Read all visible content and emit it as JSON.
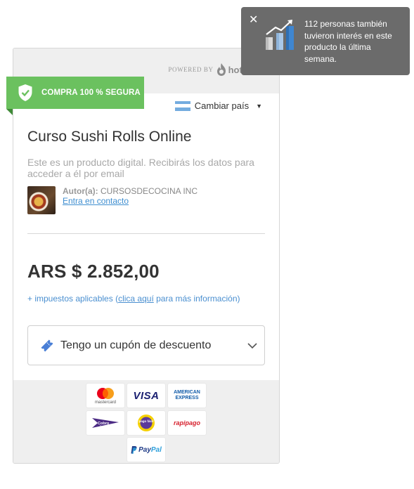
{
  "header": {
    "powered_by": "POWERED BY",
    "brand": "hotmart"
  },
  "badge": {
    "label": "COMPRA 100 % SEGURA"
  },
  "country": {
    "label": "Cambiar país",
    "flag_colors": [
      "#74acdf",
      "#ffffff",
      "#74acdf"
    ]
  },
  "product": {
    "title": "Curso Sushi Rolls Online",
    "description": "Este es un producto digital. Recibirás los datos para acceder a él por email",
    "author_label": "Autor(a):",
    "author_name": "CURSOSDECOCINA INC",
    "contact_link": "Entra en contacto"
  },
  "pricing": {
    "price": "ARS $ 2.852,00",
    "taxes_prefix": "+ impuestos aplicables (",
    "taxes_link": "clica aquí",
    "taxes_suffix": " para más información)"
  },
  "coupon": {
    "label": "Tengo un cupón de descuento"
  },
  "payment_methods": [
    {
      "name": "mastercard",
      "label": "mastercard"
    },
    {
      "name": "visa",
      "label": "VISA"
    },
    {
      "name": "amex",
      "label_1": "AMERICAN",
      "label_2": "EXPRESS"
    },
    {
      "name": "cobro-express",
      "label_1": "Cobro",
      "label_2": "Express"
    },
    {
      "name": "pago-facil",
      "label": "pago fácil"
    },
    {
      "name": "rapipago",
      "label": "rapipago"
    },
    {
      "name": "paypal",
      "label_1": "Pay",
      "label_2": "Pal"
    }
  ],
  "notification": {
    "message": "112 personas también tuvieron interés en este producto la última semana."
  },
  "colors": {
    "badge_green": "#6bc15f",
    "link_blue": "#3e8ed0",
    "toast_gray": "#6b6b6b"
  }
}
